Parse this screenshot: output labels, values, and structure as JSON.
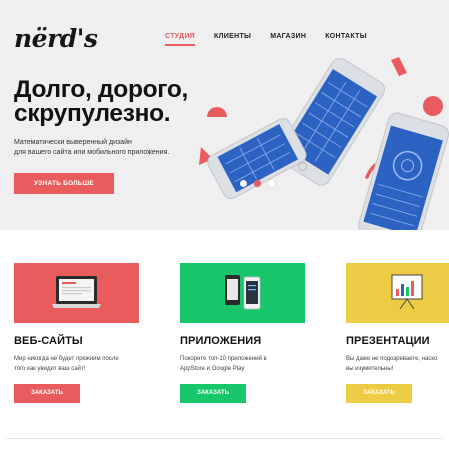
{
  "brand": {
    "logo": "nërd's"
  },
  "nav": {
    "items": [
      "СТУДИЯ",
      "КЛИЕНТЫ",
      "МАГАЗИН",
      "КОНТАКТЫ"
    ],
    "active": "СТУДИЯ"
  },
  "hero": {
    "headline_line1": "Долго, дорого,",
    "headline_line2": "скрупулезно.",
    "subtext_line1": "Математически выверенный дизайн",
    "subtext_line2": "для вашего сайта или мобильного приложения.",
    "button": "УЗНАТЬ БОЛЬШЕ",
    "slides_total": 3,
    "active_slide": 2
  },
  "colors": {
    "accent": "#e95c5e",
    "green": "#19c66b",
    "yellow": "#eecb45",
    "hero_bg": "#efefef"
  },
  "services": [
    {
      "title": "ВЕБ-САЙТЫ",
      "desc_line1": "Мир никогда не будет прежним после",
      "desc_line2": "того как увидит ваш сайт!",
      "button": "ЗАКАЗАТЬ",
      "icon": "laptop-icon"
    },
    {
      "title": "ПРИЛОЖЕНИЯ",
      "desc_line1": "Покорите топ-10 приложений в",
      "desc_line2": "AppStore и Google Play",
      "button": "ЗАКАЗАТЬ",
      "icon": "phones-icon"
    },
    {
      "title": "ПРЕЗЕНТАЦИИ",
      "desc_line1": "Вы даже не подозреваете, наско",
      "desc_line2": "вы изумительны!",
      "button": "ЗАКАЗАТЬ",
      "icon": "presentation-board-icon"
    }
  ]
}
